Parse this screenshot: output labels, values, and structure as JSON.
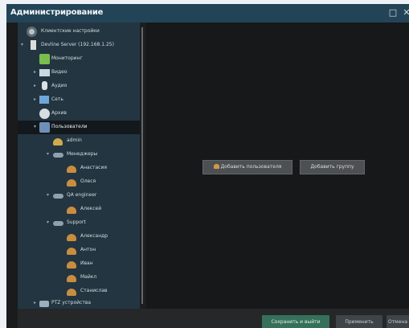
{
  "window": {
    "title": "Администрирование",
    "maximize_icon": "maximize-icon",
    "close_icon": "close-icon",
    "colors": {
      "titlebar": "#234457",
      "sidebar": "#233540",
      "main": "#171819",
      "save_button": "#35715a"
    }
  },
  "tree": {
    "client_settings": "Клиентские настройки",
    "server": "Devline Server (192.168.1.25)",
    "monitoring": "Мониторинг",
    "video": "Видео",
    "audio": "Аудио",
    "network": "Сеть",
    "archive": "Архив",
    "users": "Пользователи",
    "admin": "admin",
    "managers_group": "Менеджеры",
    "anastasia": "Анастасия",
    "olesya": "Олеся",
    "qa_group": "QA engineer",
    "alexey": "Алексей",
    "support_group": "Support",
    "alexander": "Александр",
    "anton": "Антон",
    "ivan": "Иван",
    "maxim": "Майкл",
    "stanislav": "Станислав",
    "ptz": "PTZ устройства"
  },
  "main": {
    "add_user_button": "Добавить пользователя",
    "add_group_button": "Добавить группу"
  },
  "footer": {
    "save_exit_button": "Сохранить и выйти",
    "apply_button": "Применить",
    "cancel_button": "Отмена"
  }
}
